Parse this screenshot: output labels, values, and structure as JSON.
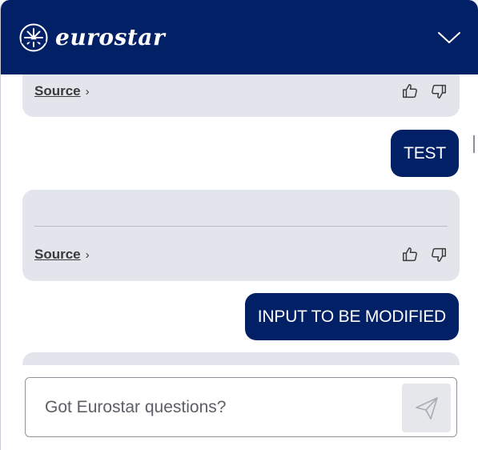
{
  "header": {
    "brand": "eurostar",
    "logo_icon": "eurostar-star-logo-icon",
    "collapse_icon": "chevron-down-icon",
    "background": "#022066"
  },
  "messages": [
    {
      "type": "bot",
      "source_label": "Source",
      "source_chevron": "›",
      "icons": [
        "thumbs-up-icon",
        "thumbs-down-icon"
      ]
    },
    {
      "type": "user",
      "text": "TEST"
    },
    {
      "type": "bot",
      "source_label": "Source",
      "source_chevron": "›",
      "icons": [
        "thumbs-up-icon",
        "thumbs-down-icon"
      ]
    },
    {
      "type": "user",
      "text": "INPUT TO BE MODIFIED"
    }
  ],
  "input": {
    "placeholder": "Got Eurostar questions?",
    "value": "",
    "send_icon": "send-icon"
  },
  "colors": {
    "brand_navy": "#022066",
    "bot_bubble": "#e3e5ec",
    "send_button_disabled": "#e6e7ea"
  }
}
